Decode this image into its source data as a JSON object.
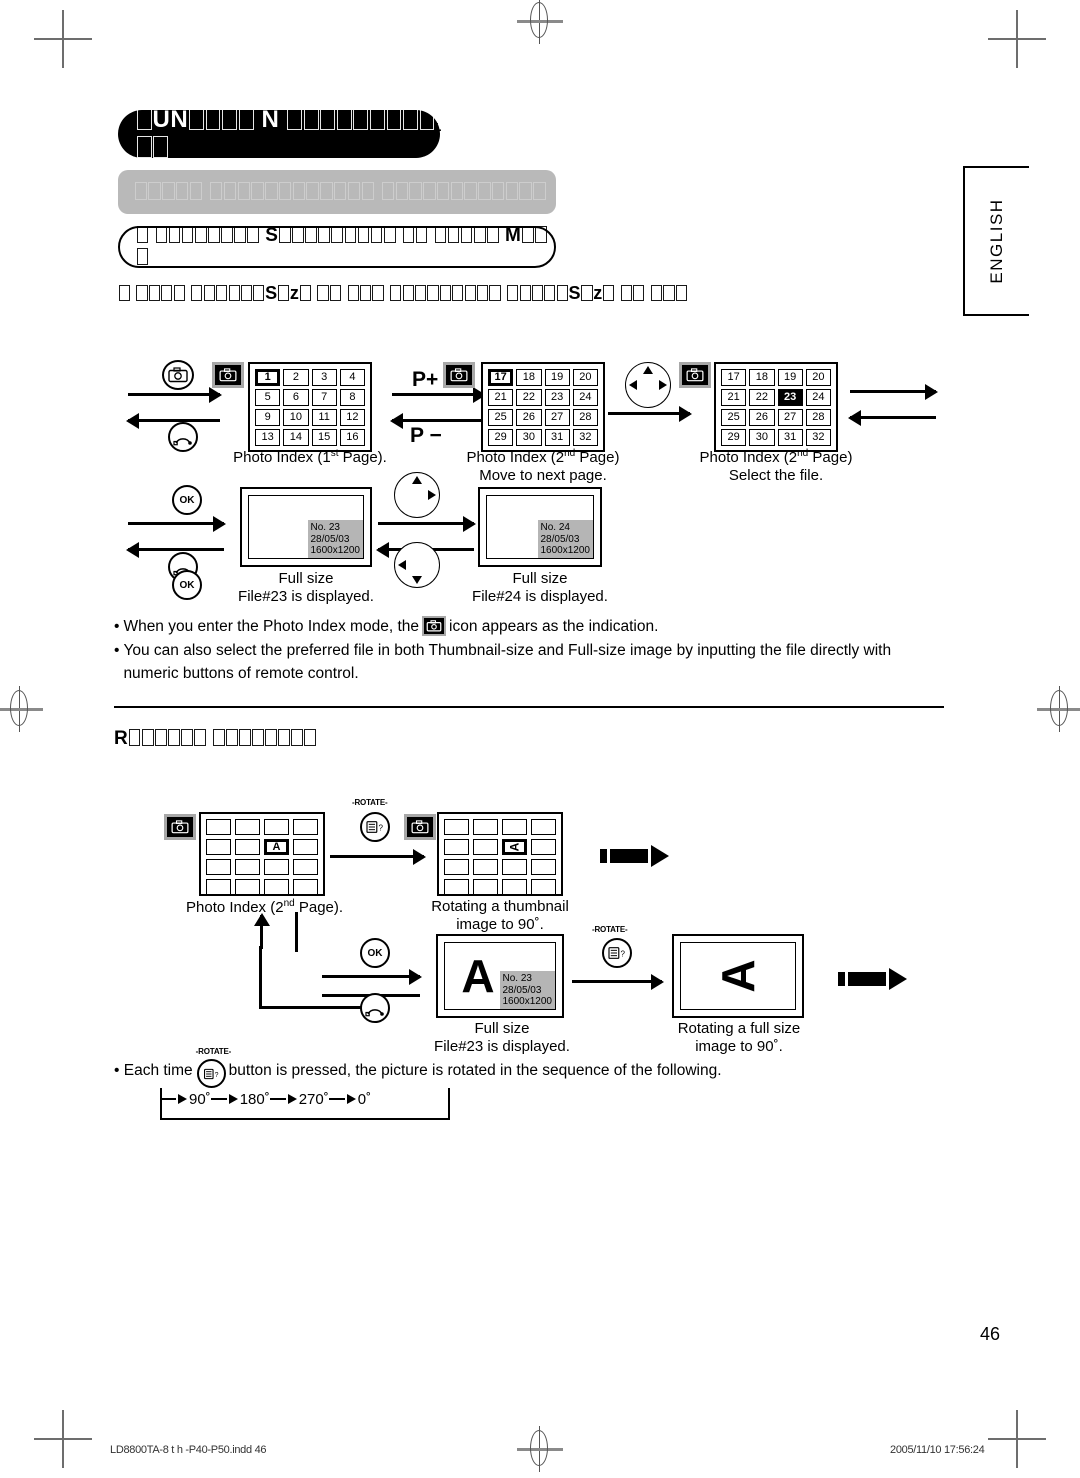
{
  "page": {
    "number": "46",
    "language_tab": "ENGLISH"
  },
  "headings": {
    "pill": "□UN□□□□ N □□□□□□□□□□□",
    "pill_tail": "t.",
    "gray_bar": "□□□□□ □□□□□□□□□□□□ □□□□□□□□□□□□",
    "rounded_box": "□ □□□□□□□□ S□□□□□□□□□ □□ □□□□□ M□□□",
    "sub_heading": "□ □□□□ □□□□□□S□z□ □□ □□□ □□□□□□□□□ □□□□□S□z□ □□ □□□",
    "rotate_section": "R□□□□□□ □□□□□□□□"
  },
  "photo_index": {
    "page1": {
      "cells": [
        "1",
        "2",
        "3",
        "4",
        "5",
        "6",
        "7",
        "8",
        "9",
        "10",
        "11",
        "12",
        "13",
        "14",
        "15",
        "16"
      ],
      "selected": "1",
      "caption_line1": "Photo Index (1st Page).",
      "caption_main": "Photo Index (1",
      "caption_sup": "st",
      "caption_rest": " Page)."
    },
    "page2_move": {
      "cells": [
        "17",
        "18",
        "19",
        "20",
        "21",
        "22",
        "23",
        "24",
        "25",
        "26",
        "27",
        "28",
        "29",
        "30",
        "31",
        "32"
      ],
      "selected": "17",
      "caption_main": "Photo Index (2",
      "caption_sup": "nd",
      "caption_rest": " Page)",
      "caption_line2": "Move to next page."
    },
    "page2_select": {
      "cells": [
        "17",
        "18",
        "19",
        "20",
        "21",
        "22",
        "23",
        "24",
        "25",
        "26",
        "27",
        "28",
        "29",
        "30",
        "31",
        "32"
      ],
      "selected": "23",
      "caption_main": "Photo Index (2",
      "caption_sup": "nd",
      "caption_rest": " Page)",
      "caption_line2": "Select the file."
    },
    "channel_up": "P+",
    "channel_down": "P −"
  },
  "full_size": {
    "file23": {
      "osd_no": "No. 23",
      "osd_date": "28/05/03",
      "osd_res": "1600x1200",
      "caption_line1": "Full size",
      "caption_line2": "File#23 is displayed."
    },
    "file24": {
      "osd_no": "No. 24",
      "osd_date": "28/05/03",
      "osd_res": "1600x1200",
      "caption_line1": "Full size",
      "caption_line2": "File#24 is displayed."
    }
  },
  "buttons": {
    "ok": "OK",
    "rotate_label": "-ROTATE-"
  },
  "bullets": [
    {
      "before": "When you enter the Photo Index mode, the",
      "after": "icon appears as the indication."
    },
    {
      "text": "You can also select the preferred file in both Thumbnail-size and Full-size image by inputting the file directly with numeric buttons of remote control."
    }
  ],
  "rotate": {
    "thumb_marker": "A",
    "index_caption_main": "Photo Index (2",
    "index_caption_sup": "nd",
    "index_caption_rest": " Page).",
    "thumb_rot_caption_line1": "Rotating a thumbnail",
    "thumb_rot_caption_line2": "image to 90˚.",
    "full_caption_line1": "Full size",
    "full_caption_line2": "File#23 is displayed.",
    "full_rot_caption_line1": "Rotating a full size",
    "full_rot_caption_line2": "image to 90˚.",
    "full_osd_no": "No. 23",
    "full_osd_date": "28/05/03",
    "full_osd_res": "1600x1200",
    "big_letter": "A"
  },
  "note": {
    "before": "Each time",
    "after": "button is pressed, the picture is rotated in the sequence of the following.",
    "sequence": [
      "90˚",
      "180˚",
      "270˚",
      "0˚"
    ]
  },
  "footer": {
    "left": "LD8800TA-8 t  h -P40-P50.indd   46",
    "right": "2005/11/10   17:56:24"
  }
}
